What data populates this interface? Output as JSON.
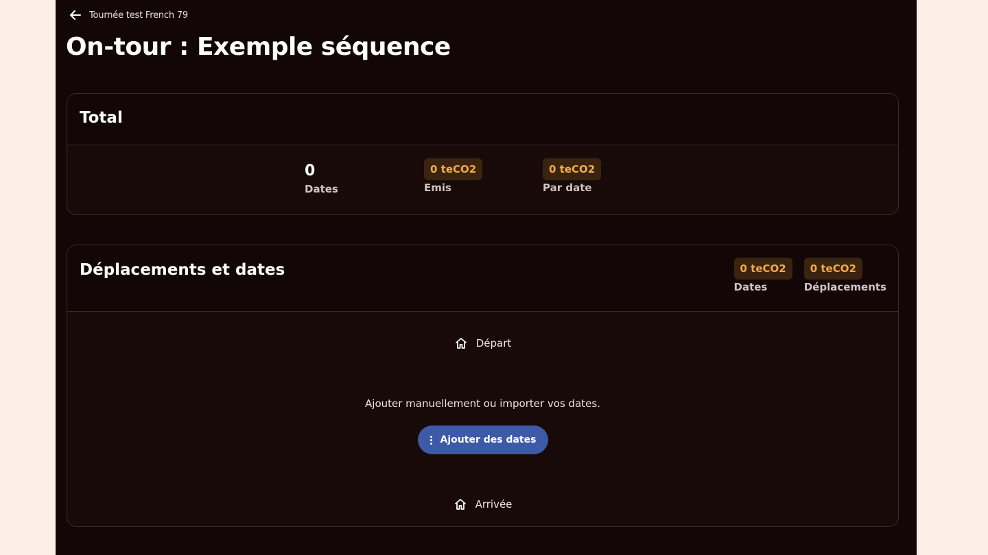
{
  "header": {
    "back_label": "Tournée test French 79",
    "back_icon": "arrow-left-icon",
    "title": "On-tour : Exemple séquence"
  },
  "total": {
    "title": "Total",
    "stats": [
      {
        "value": "0",
        "label": "Dates"
      },
      {
        "value": "0 teCO2",
        "label": "Emis"
      },
      {
        "value": "0 teCO2",
        "label": "Par date"
      }
    ]
  },
  "moves": {
    "title": "Déplacements et dates",
    "stats": [
      {
        "value": "0 teCO2",
        "label": "Dates"
      },
      {
        "value": "0 teCO2",
        "label": "Déplacements"
      }
    ],
    "start_label": "Départ",
    "empty_text": "Ajouter manuellement ou importer vos dates.",
    "add_button_label": "Ajouter des dates",
    "end_label": "Arrivée",
    "home_icon": "home-icon",
    "menu_icon": "more-vertical-icon"
  },
  "colors": {
    "page_background": "#fdeee6",
    "app_background": "#120606",
    "accent_pill_background": "#3a2410",
    "accent_pill_text": "#f3a94a",
    "primary_button": "#3d5aa8"
  }
}
